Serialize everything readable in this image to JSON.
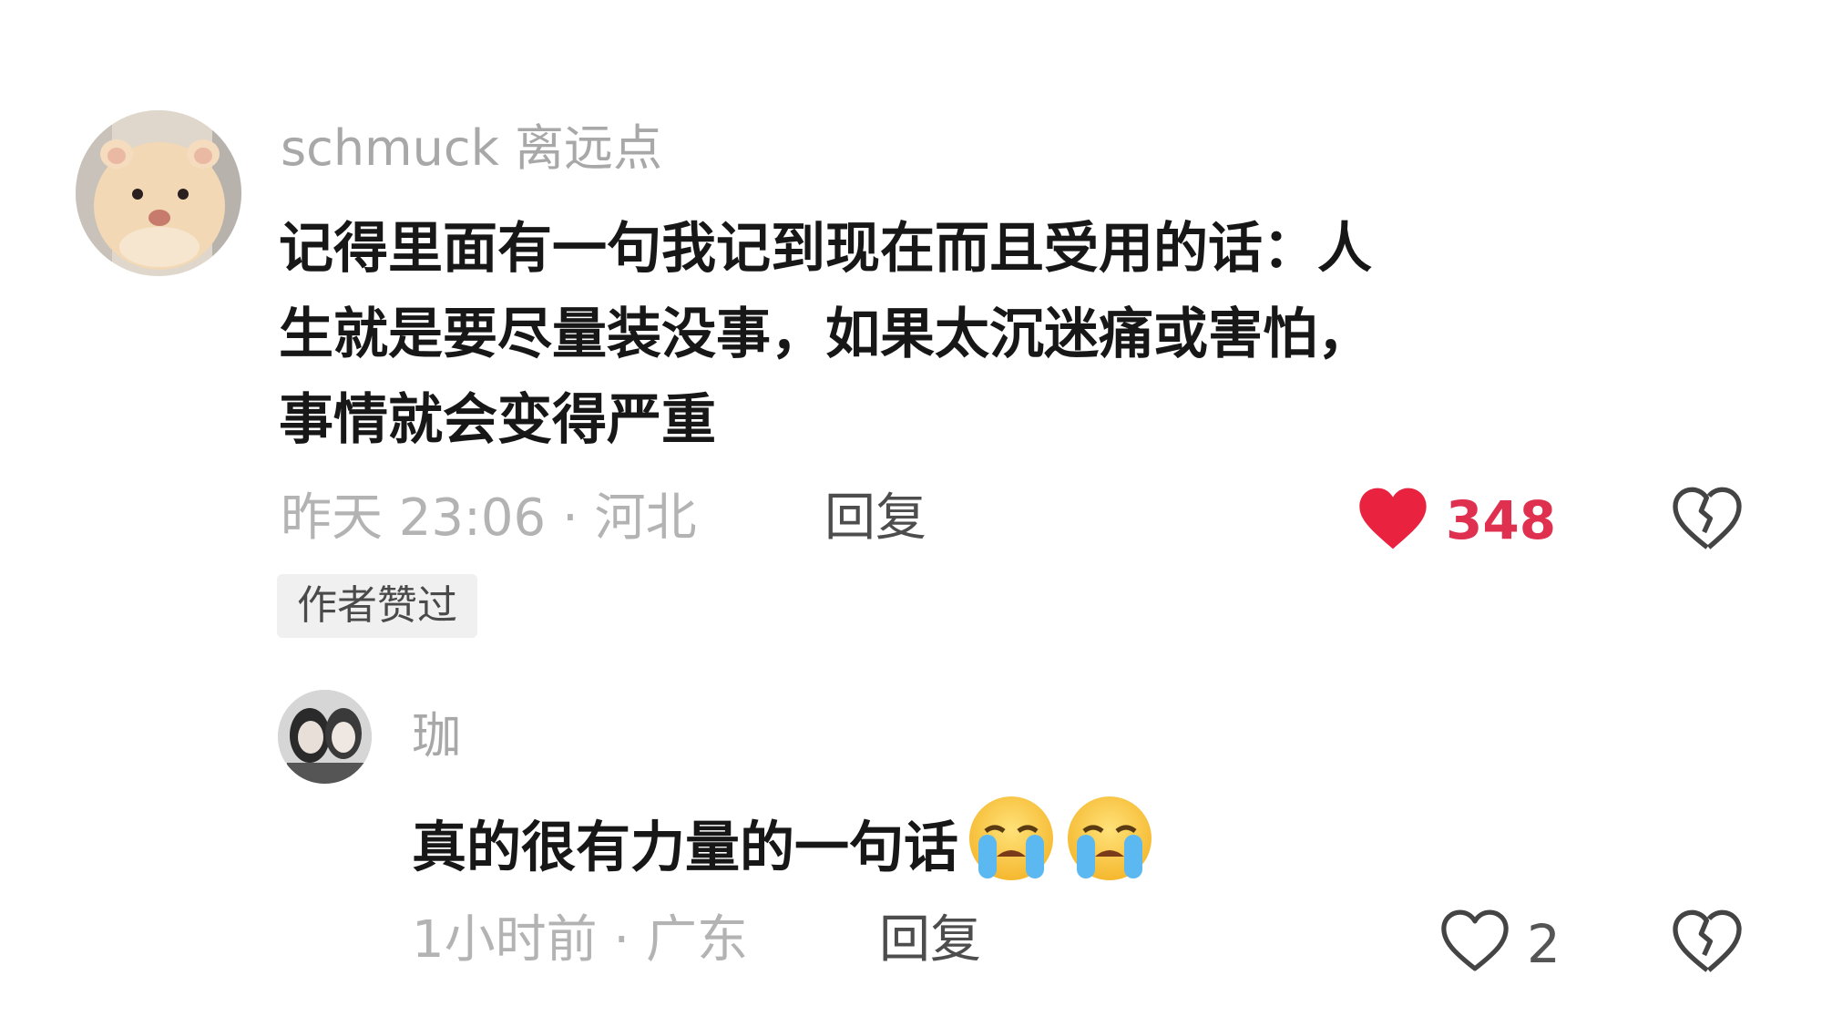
{
  "comment": {
    "username": "schmuck 离远点",
    "text_lines": [
      "记得里面有一句我记到现在而且受用的话：人",
      "生就是要尽量装没事，如果太沉迷痛或害怕，",
      "事情就会变得严重"
    ],
    "time_location": "昨天 23:06 · 河北",
    "reply_label": "回复",
    "like_count": "348",
    "liked": true,
    "badge": "作者赞过",
    "colors": {
      "liked": "#e8223f",
      "count": "#e03050"
    },
    "icons": [
      "avatar-hamster",
      "heart-filled-icon",
      "broken-heart-icon"
    ]
  },
  "reply": {
    "username": "珈",
    "text": "真的很有力量的一句话",
    "emoji": [
      "loudly-crying-face",
      "loudly-crying-face"
    ],
    "time_location": "1小时前 · 广东",
    "reply_label": "回复",
    "like_count": "2",
    "liked": false,
    "icons": [
      "avatar-photo",
      "heart-outline-icon",
      "broken-heart-icon"
    ]
  }
}
